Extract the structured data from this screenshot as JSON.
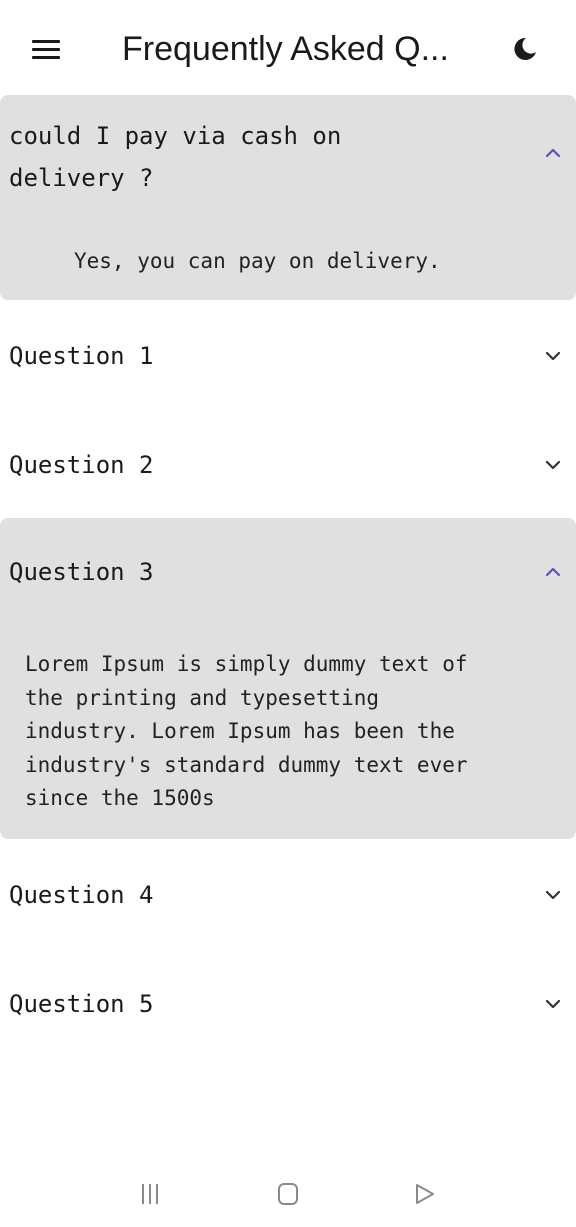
{
  "app_bar": {
    "title": "Frequently Asked Q...",
    "menu_icon": "hamburger-menu-icon",
    "theme_icon": "dark-mode-moon-icon"
  },
  "faq": [
    {
      "question": "could I pay via cash on\ndelivery ?",
      "answer": "Yes, you can pay on delivery.",
      "expanded": true
    },
    {
      "question": "Question 1",
      "expanded": false
    },
    {
      "question": "Question 2",
      "expanded": false
    },
    {
      "question": "Question 3",
      "answer": "Lorem Ipsum is simply dummy text of\nthe printing and typesetting\nindustry. Lorem Ipsum has been the\nindustry's standard dummy text ever\nsince the 1500s",
      "expanded": true
    },
    {
      "question": "Question 4",
      "expanded": false
    },
    {
      "question": "Question 5",
      "expanded": false
    }
  ],
  "colors": {
    "expanded_background": "#e0e0e0",
    "chevron_expanded": "#5c4fb8",
    "chevron_collapsed": "#333333"
  },
  "nav_bar": {
    "icons": [
      "recent-apps-icon",
      "home-icon",
      "back-icon"
    ]
  }
}
